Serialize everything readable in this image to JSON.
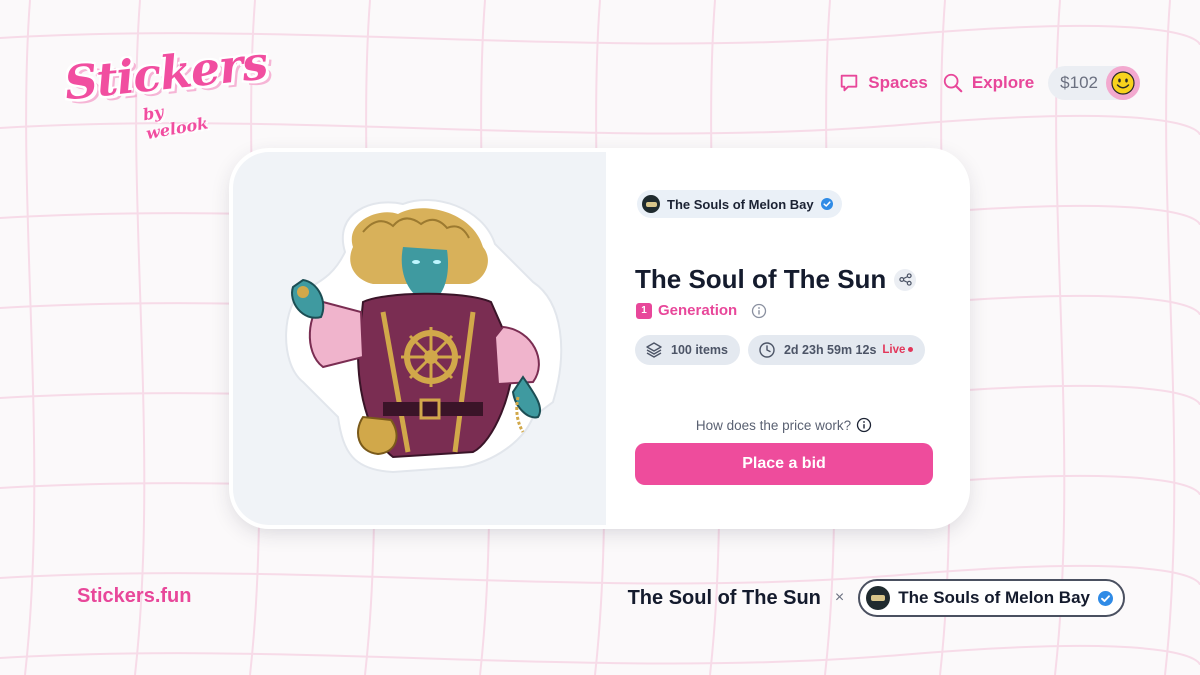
{
  "brand": {
    "logo_text": "Stickers",
    "logo_subtext": "by welook",
    "site": "Stickers.fun",
    "accent_color": "#e8479a"
  },
  "nav": {
    "spaces_label": "Spaces",
    "spaces_icon": "chat-bubble-icon",
    "explore_label": "Explore",
    "explore_icon": "search-icon",
    "balance": "$102",
    "avatar_icon": "smiley-face-icon"
  },
  "card": {
    "collection_name": "The Souls of Melon Bay",
    "collection_verified": true,
    "title": "The Soul of The Sun",
    "generation_number": "1",
    "generation_label": "Generation",
    "items_label": "100 items",
    "timer": "2d 23h 59m 12s",
    "live_label": "Live",
    "price_help": "How does the price work?",
    "bid_button": "Place a bid",
    "image_alt": "sticker illustration of a blue-skinned figure with wild golden hair in a purple and gold pirate coat holding a ship wheel"
  },
  "footer": {
    "title": "The Soul of The Sun",
    "separator": "×",
    "collection_name": "The Souls of Melon Bay"
  }
}
